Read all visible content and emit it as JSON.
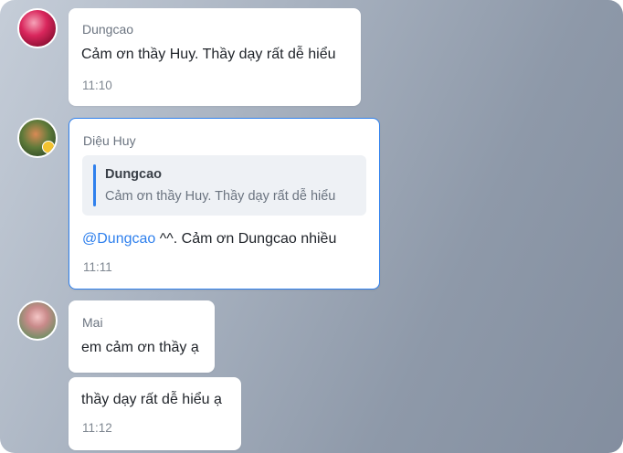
{
  "messages": [
    {
      "sender": "Dungcao",
      "text": "Cảm ơn thầy Huy. Thầy dạy rất dễ hiểu",
      "time": "11:10"
    },
    {
      "sender": "Diệu Huy",
      "reply_to": {
        "sender": "Dungcao",
        "text": "Cảm ơn thầy Huy. Thầy dạy rất dễ hiểu"
      },
      "mention": "@Dungcao",
      "text": " ^^. Cảm ơn Dungcao nhiều",
      "time": "11:11"
    },
    {
      "sender": "Mai",
      "text": "em cảm ơn thầy ạ"
    },
    {
      "text": "thầy dạy rất dễ hiểu ạ",
      "time": "11:12"
    }
  ],
  "colors": {
    "accent": "#2f80ed",
    "bubble": "#ffffff",
    "quote_bg": "#eef1f5"
  }
}
